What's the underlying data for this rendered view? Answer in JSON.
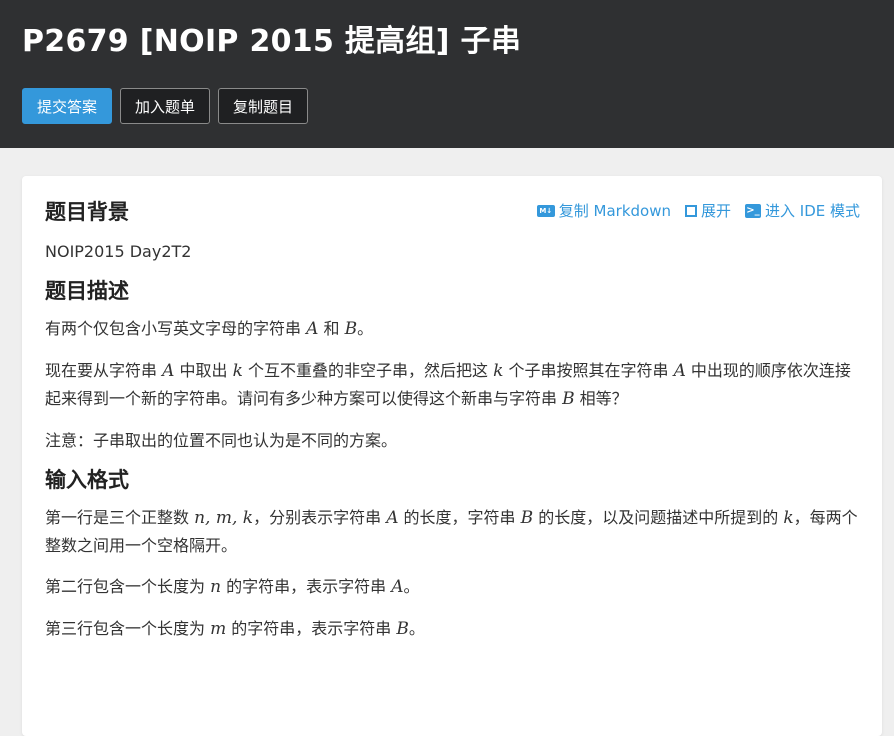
{
  "header": {
    "title": "P2679 [NOIP 2015 提高组] 子串",
    "buttons": {
      "submit": "提交答案",
      "add_to_list": "加入题单",
      "copy_problem": "复制题目"
    }
  },
  "toolbar": {
    "copy_markdown": "复制 Markdown",
    "expand": "展开",
    "enter_ide": "进入 IDE 模式"
  },
  "background": {
    "heading": "题目背景",
    "text": "NOIP2015 Day2T2"
  },
  "description": {
    "heading": "题目描述",
    "p1": {
      "a": "有两个仅包含小写英文字母的字符串 ",
      "v1": "A",
      "b": " 和 ",
      "v2": "B",
      "c": "。"
    },
    "p2": {
      "a": "现在要从字符串 ",
      "v1": "A",
      "b": " 中取出 ",
      "v2": "k",
      "c": " 个互不重叠的非空子串，然后把这 ",
      "v3": "k",
      "d": " 个子串按照其在字符串 ",
      "v4": "A",
      "e": " 中出现的顺序依次连接起来得到一个新的字符串。请问有多少种方案可以使得这个新串与字符串 ",
      "v5": "B",
      "f": " 相等？"
    },
    "p3": "注意：子串取出的位置不同也认为是不同的方案。"
  },
  "input_format": {
    "heading": "输入格式",
    "p1": {
      "a": "第一行是三个正整数 ",
      "v1": "n, m, k",
      "b": "，分别表示字符串 ",
      "v2": "A",
      "c": " 的长度，字符串 ",
      "v3": "B",
      "d": " 的长度，以及问题描述中所提到的 ",
      "v4": "k",
      "e": "，每两个整数之间用一个空格隔开。"
    },
    "p2": {
      "a": "第二行包含一个长度为 ",
      "v1": "n",
      "b": " 的字符串，表示字符串 ",
      "v2": "A",
      "c": "。"
    },
    "p3": {
      "a": "第三行包含一个长度为 ",
      "v1": "m",
      "b": " 的字符串，表示字符串 ",
      "v2": "B",
      "c": "。"
    }
  },
  "colors": {
    "header_bg": "#2f3032",
    "accent": "#3498db",
    "page_bg": "#efefef"
  },
  "icons": [
    "markdown-icon",
    "expand-icon",
    "terminal-icon"
  ]
}
